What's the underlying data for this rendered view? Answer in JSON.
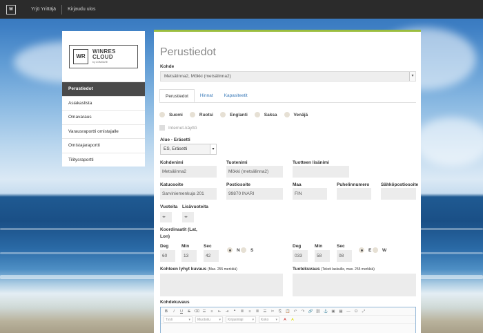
{
  "topbar": {
    "logo": "W",
    "user": "Yrjö Yrittäjä",
    "logout": "Kirjaudu ulos"
  },
  "brand": {
    "mark": "WR",
    "name_line1": "WINRES",
    "name_line2": "CLOUD",
    "tagline": "by COMGATE"
  },
  "sidebar": {
    "items": [
      {
        "label": "Perustiedot",
        "active": true
      },
      {
        "label": "Asiakaslista"
      },
      {
        "label": "Omavaraus"
      },
      {
        "label": "Varausraportti omistajalle"
      },
      {
        "label": "Omistajaraportti"
      },
      {
        "label": "Tilitysraportti"
      }
    ]
  },
  "main": {
    "title": "Perustiedot",
    "kohde_label": "Kohde",
    "kohde_value": "Metsälinna2, Mökki (metsälinna2)",
    "tabs": [
      "Perustiedot",
      "Hinnat",
      "Kapasiteetit"
    ],
    "languages": [
      "Suomi",
      "Ruotsi",
      "Englanti",
      "Saksa",
      "Venäjä"
    ],
    "internet_label": "Internet-käyttö",
    "alue_label": "Alue - Eräsetti",
    "alue_value": "ES, Eräsetti",
    "kohdenimi_label": "Kohdenimi",
    "kohdenimi_value": "Metsälinna2",
    "tuotenimi_label": "Tuotenimi",
    "tuotenimi_value": "Mökki (metsälinna2)",
    "lisanimi_label": "Tuotteen lisänimi",
    "katuosoite_label": "Katuosoite",
    "katuosoite_value": "Sarviniemenkuja 201",
    "postiosoite_label": "Postiosoite",
    "postiosoite_value": "99870  INARI",
    "maa_label": "Maa",
    "maa_value": "FIN",
    "puhelin_label": "Puhelinnumero",
    "sahkoposti_label": "Sähköpostiosoite",
    "vuoteita_label": "Vuoteita",
    "lisavuoteita_label": "Lisävuoteita",
    "koordinaatit_label": "Koordinaatit (Lat, Lon)",
    "lat": {
      "deg_label": "Deg",
      "min_label": "Min",
      "sec_label": "Sec",
      "deg": "60",
      "min": "13",
      "sec": "42",
      "n": "N",
      "s": "S"
    },
    "lon": {
      "deg_label": "Deg",
      "min_label": "Min",
      "sec_label": "Sec",
      "deg": "033",
      "min": "58",
      "sec": "08",
      "e": "E",
      "w": "W"
    },
    "lyhyt_label": "Kohteen lyhyt kuvaus",
    "lyhyt_hint": "(Max. 255 merkkiä)",
    "tuotekuvaus_label": "Tuotekuvaus",
    "tuotekuvaus_hint": "(Teksti laskuille, max. 255 merkkiä)",
    "kohdekuvaus_label": "Kohdekuvaus",
    "editor": {
      "selects": [
        "Tyyli",
        "Muotoilu",
        "Kirjasinlaji",
        "Koko"
      ]
    }
  }
}
